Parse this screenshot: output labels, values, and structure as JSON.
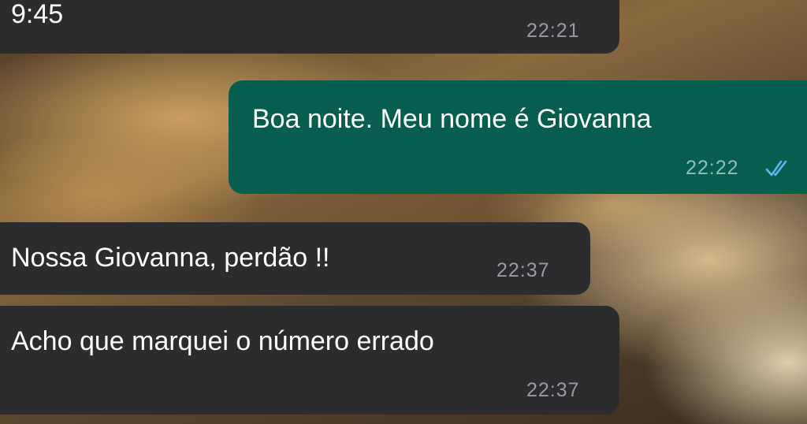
{
  "chat": {
    "accent_incoming_bg": "#2c2c2e",
    "accent_outgoing_bg": "#075e4f",
    "read_tick_color": "#5eb6e8",
    "messages": [
      {
        "direction": "incoming",
        "text": "9:45",
        "time": "22:21"
      },
      {
        "direction": "outgoing",
        "text": "Boa noite. Meu nome é Giovanna",
        "time": "22:22",
        "status_icon": "double-check-read-icon"
      },
      {
        "direction": "incoming",
        "text": "Nossa Giovanna, perdão !!",
        "time": "22:37"
      },
      {
        "direction": "incoming",
        "text": "Acho que marquei o número errado",
        "time": "22:37"
      }
    ]
  }
}
